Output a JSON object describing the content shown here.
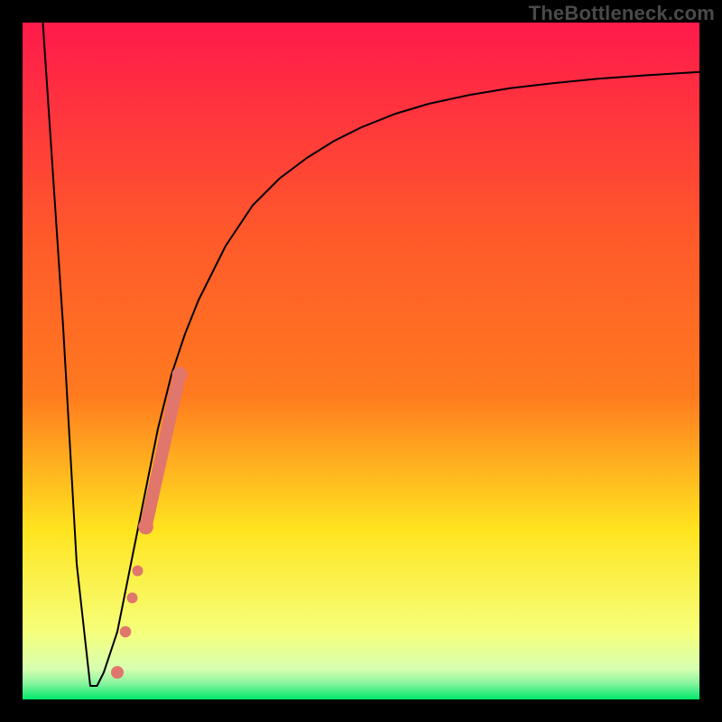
{
  "watermark": "TheBottleneck.com",
  "colors": {
    "gradient_top": "#ff1a4b",
    "gradient_mid1": "#ff7a1f",
    "gradient_mid2": "#ffe41f",
    "gradient_mid3": "#f6ff7a",
    "gradient_bottom": "#00e86b",
    "curve_stroke": "#000000",
    "marker_fill": "#e0766c"
  },
  "chart_data": {
    "type": "line",
    "title": "",
    "xlabel": "",
    "ylabel": "",
    "xlim": [
      0,
      100
    ],
    "ylim": [
      0,
      100
    ],
    "series": [
      {
        "name": "bottleneck-curve",
        "x": [
          3,
          6,
          8,
          10,
          11,
          12,
          14,
          16,
          18,
          20,
          22,
          24,
          26,
          28,
          30,
          34,
          38,
          42,
          46,
          50,
          55,
          60,
          66,
          72,
          78,
          85,
          92,
          100
        ],
        "y": [
          100,
          55,
          20,
          2,
          2,
          4,
          10,
          20,
          30,
          40,
          48,
          54,
          59,
          63,
          67,
          73,
          77,
          80,
          82.5,
          84.5,
          86.5,
          88,
          89.3,
          90.3,
          91,
          91.7,
          92.2,
          92.7
        ]
      }
    ],
    "markers": [
      {
        "name": "cluster-point",
        "x": 14.0,
        "y": 4.0,
        "r": 1.0
      },
      {
        "name": "cluster-point",
        "x": 15.2,
        "y": 10.0,
        "r": 0.9
      },
      {
        "name": "cluster-point",
        "x": 16.2,
        "y": 15.0,
        "r": 0.85
      },
      {
        "name": "cluster-point",
        "x": 17.0,
        "y": 19.0,
        "r": 0.85
      },
      {
        "name": "cluster-start",
        "x": 18.2,
        "y": 25.5,
        "r": 1.2
      },
      {
        "name": "cluster-end",
        "x": 23.2,
        "y": 48.0,
        "r": 1.2
      }
    ]
  }
}
